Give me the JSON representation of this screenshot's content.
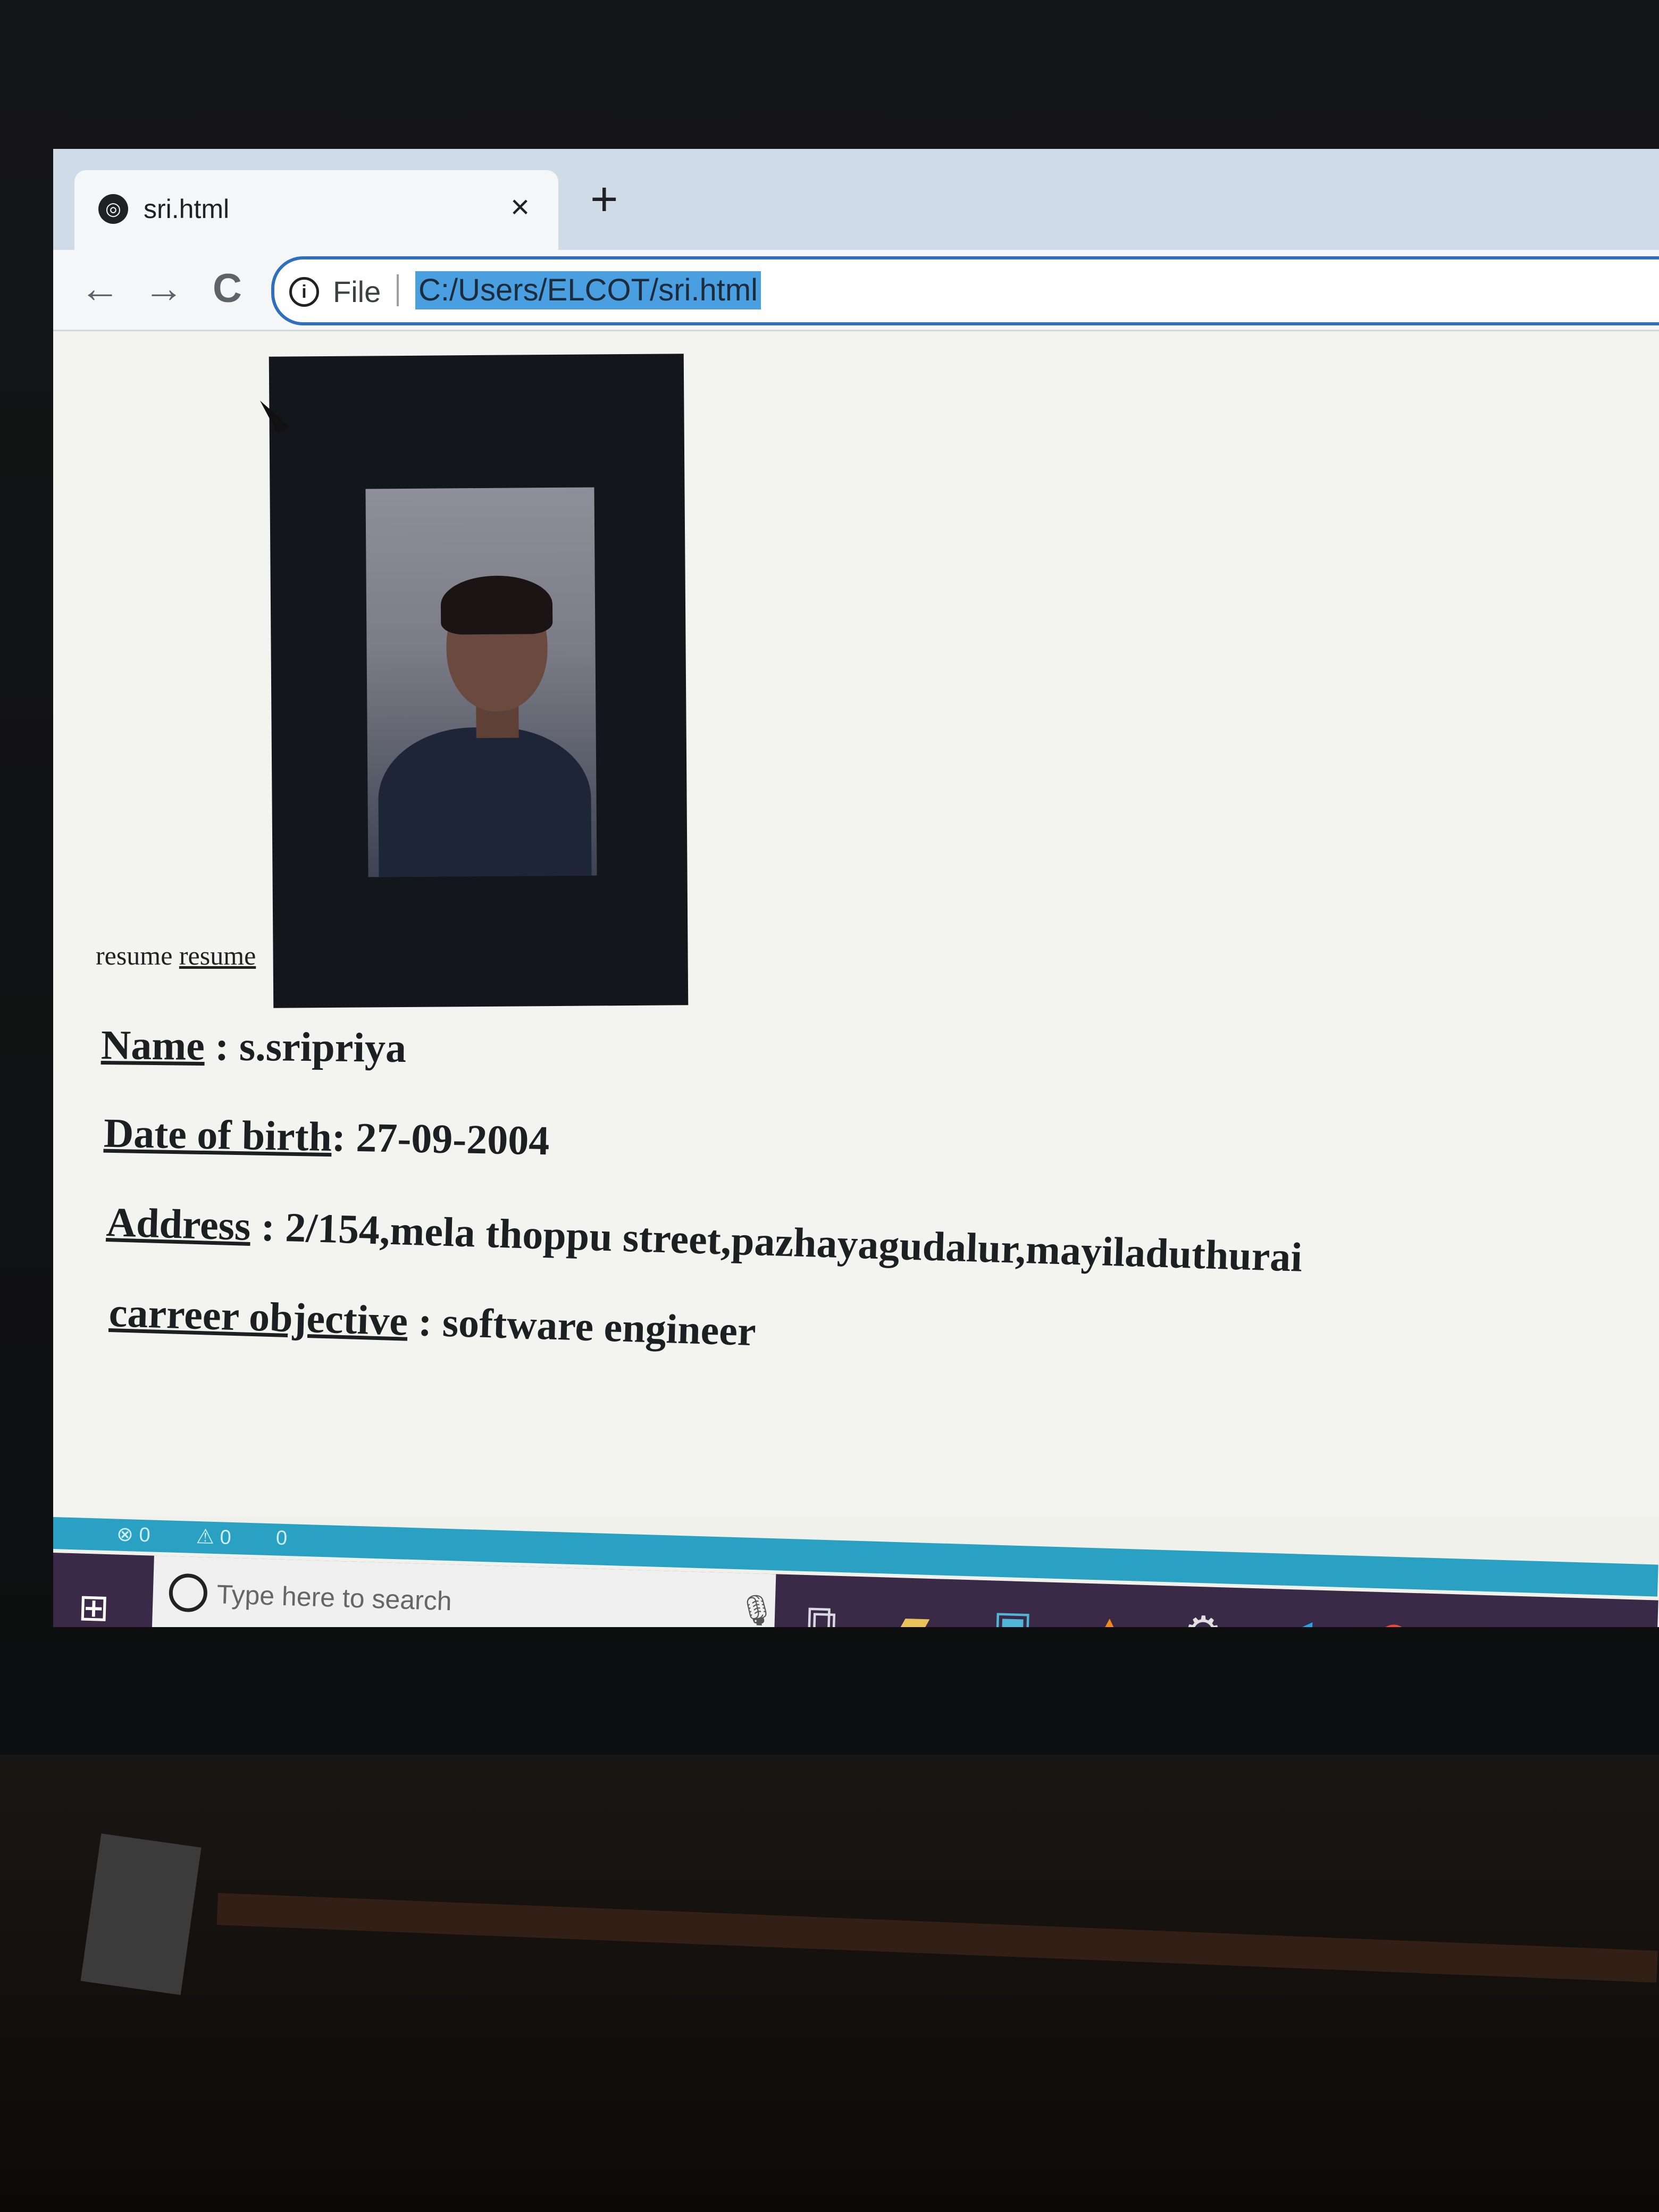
{
  "browser": {
    "tab_title": "sri.html",
    "tab_close": "×",
    "new_tab": "+",
    "back": "←",
    "forward": "→",
    "reload": "C",
    "info": "i",
    "file_label": "File",
    "url": "C:/Users/ELCOT/sri.html"
  },
  "page": {
    "resume_text": "resume",
    "resume_link": "resume",
    "fields": [
      {
        "key": "Name",
        "value": " : s.sripriya"
      },
      {
        "key": "Date of birth",
        "value": ": 27-09-2004"
      },
      {
        "key": "Address",
        "value": " : 2/154,mela thoppu street,pazhayagudalur,mayiladuthurai"
      },
      {
        "key": "carreer objective",
        "value": " : software engineer"
      }
    ]
  },
  "vscode_status": {
    "errors": "⊗ 0",
    "warnings": "⚠ 0",
    "ports": "0"
  },
  "taskbar": {
    "search_placeholder": "Type here to search",
    "icons": [
      "windows-start-icon",
      "task-view-icon",
      "file-explorer-icon",
      "network-icon",
      "vlc-icon",
      "settings-icon",
      "vscode-icon",
      "chrome-icon"
    ]
  },
  "colors": {
    "taskbar": "#3a2a47",
    "vscode_status": "#2aa0c2",
    "url_highlight": "#4a9fe0"
  }
}
